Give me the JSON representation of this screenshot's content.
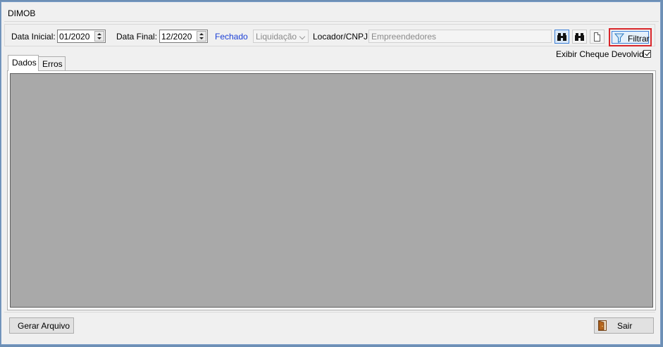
{
  "window": {
    "title": "DIMOB"
  },
  "filters": {
    "start_label": "Data Inicial:",
    "start_value": "01/2020",
    "end_label": "Data Final:",
    "end_value": "12/2020",
    "status_text": "Fechado",
    "type_value": "Liquidação",
    "locador_label": "Locador/CNPJ:",
    "locador_value": "Empreendedores",
    "filter_button": "Filtrar",
    "show_returned_check_label": "Exibir Cheque Devolvido",
    "show_returned_checked": true
  },
  "tabs": [
    {
      "label": "Dados",
      "active": true
    },
    {
      "label": "Erros",
      "active": false
    }
  ],
  "footer": {
    "generate_button": "Gerar Arquivo",
    "exit_button": "Sair"
  },
  "icons": [
    "binoculars-icon",
    "binoculars-icon",
    "document-icon",
    "funnel-icon",
    "door-exit-icon",
    "checkmark-icon"
  ],
  "colors": {
    "status_link": "#1b3fd6",
    "highlight": "#d9262a",
    "grid_background": "#a9a9a9"
  }
}
